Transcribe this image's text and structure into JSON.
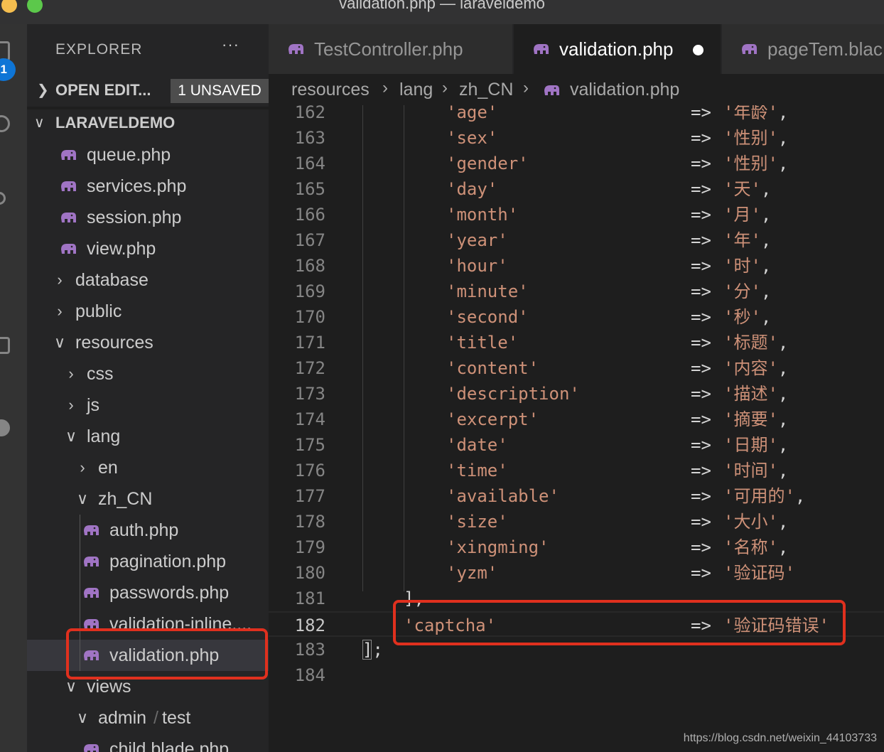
{
  "window": {
    "title": "validation.php — laraveldemo"
  },
  "activity_bar": {
    "badge": "1",
    "icons": [
      "files-icon",
      "search-icon",
      "source-control-icon",
      "run-icon",
      "extensions-icon",
      "remote-icon"
    ]
  },
  "sidebar": {
    "header": "EXPLORER",
    "more_actions": "···",
    "open_editors": {
      "label": "OPEN EDIT...",
      "badge": "1 UNSAVED"
    },
    "project": {
      "label": "LARAVELDEMO"
    },
    "tree": [
      {
        "name": "queue.php",
        "type": "php"
      },
      {
        "name": "services.php",
        "type": "php"
      },
      {
        "name": "session.php",
        "type": "php"
      },
      {
        "name": "view.php",
        "type": "php"
      },
      {
        "name": "database",
        "type": "folder",
        "expanded": false
      },
      {
        "name": "public",
        "type": "folder",
        "expanded": false
      },
      {
        "name": "resources",
        "type": "folder",
        "expanded": true
      },
      {
        "name": "css",
        "type": "folder",
        "expanded": false
      },
      {
        "name": "js",
        "type": "folder",
        "expanded": false
      },
      {
        "name": "lang",
        "type": "folder",
        "expanded": true
      },
      {
        "name": "en",
        "type": "folder",
        "expanded": false
      },
      {
        "name": "zh_CN",
        "type": "folder",
        "expanded": true
      },
      {
        "name": "auth.php",
        "type": "php"
      },
      {
        "name": "pagination.php",
        "type": "php"
      },
      {
        "name": "passwords.php",
        "type": "php"
      },
      {
        "name": "validation-inline....",
        "type": "php"
      },
      {
        "name": "validation.php",
        "type": "php",
        "selected": true
      },
      {
        "name": "views",
        "type": "folder",
        "expanded": true
      },
      {
        "name": "admin",
        "name_suffix": "test",
        "type": "folder",
        "expanded": true
      },
      {
        "name": "child.blade.php",
        "type": "php"
      }
    ]
  },
  "tabs": [
    {
      "label": "TestController.php",
      "active": false
    },
    {
      "label": "validation.php",
      "active": true,
      "dirty": true
    },
    {
      "label": "pageTem.blac",
      "active": false
    }
  ],
  "breadcrumb": [
    "resources",
    "lang",
    "zh_CN",
    "validation.php"
  ],
  "editor": {
    "current_line": "182",
    "lines": [
      {
        "n": "162",
        "key": "'age'",
        "arrow": "=>",
        "val": "'年龄'",
        "tail": ","
      },
      {
        "n": "163",
        "key": "'sex'",
        "arrow": "=>",
        "val": "'性别'",
        "tail": ","
      },
      {
        "n": "164",
        "key": "'gender'",
        "arrow": "=>",
        "val": "'性别'",
        "tail": ","
      },
      {
        "n": "165",
        "key": "'day'",
        "arrow": "=>",
        "val": "'天'",
        "tail": ","
      },
      {
        "n": "166",
        "key": "'month'",
        "arrow": "=>",
        "val": "'月'",
        "tail": ","
      },
      {
        "n": "167",
        "key": "'year'",
        "arrow": "=>",
        "val": "'年'",
        "tail": ","
      },
      {
        "n": "168",
        "key": "'hour'",
        "arrow": "=>",
        "val": "'时'",
        "tail": ","
      },
      {
        "n": "169",
        "key": "'minute'",
        "arrow": "=>",
        "val": "'分'",
        "tail": ","
      },
      {
        "n": "170",
        "key": "'second'",
        "arrow": "=>",
        "val": "'秒'",
        "tail": ","
      },
      {
        "n": "171",
        "key": "'title'",
        "arrow": "=>",
        "val": "'标题'",
        "tail": ","
      },
      {
        "n": "172",
        "key": "'content'",
        "arrow": "=>",
        "val": "'内容'",
        "tail": ","
      },
      {
        "n": "173",
        "key": "'description'",
        "arrow": "=>",
        "val": "'描述'",
        "tail": ","
      },
      {
        "n": "174",
        "key": "'excerpt'",
        "arrow": "=>",
        "val": "'摘要'",
        "tail": ","
      },
      {
        "n": "175",
        "key": "'date'",
        "arrow": "=>",
        "val": "'日期'",
        "tail": ","
      },
      {
        "n": "176",
        "key": "'time'",
        "arrow": "=>",
        "val": "'时间'",
        "tail": ","
      },
      {
        "n": "177",
        "key": "'available'",
        "arrow": "=>",
        "val": "'可用的'",
        "tail": ","
      },
      {
        "n": "178",
        "key": "'size'",
        "arrow": "=>",
        "val": "'大小'",
        "tail": ","
      },
      {
        "n": "179",
        "key": "'xingming'",
        "arrow": "=>",
        "val": "'名称'",
        "tail": ","
      },
      {
        "n": "180",
        "key": "'yzm'",
        "arrow": "=>",
        "val": "'验证码'",
        "tail": ""
      },
      {
        "n": "181",
        "plain": "],",
        "level": 1
      },
      {
        "n": "182",
        "key": "'captcha'",
        "arrow": "=>",
        "val": "'验证码错误'",
        "tail": "",
        "level": 1
      },
      {
        "n": "183",
        "plain": "];",
        "level": 0
      },
      {
        "n": "184"
      }
    ]
  },
  "watermark": "https://blog.csdn.net/weixin_44103733",
  "colors": {
    "highlight_box": "#e0301e",
    "php_icon": "#a074c4",
    "string": "#ce9178"
  }
}
